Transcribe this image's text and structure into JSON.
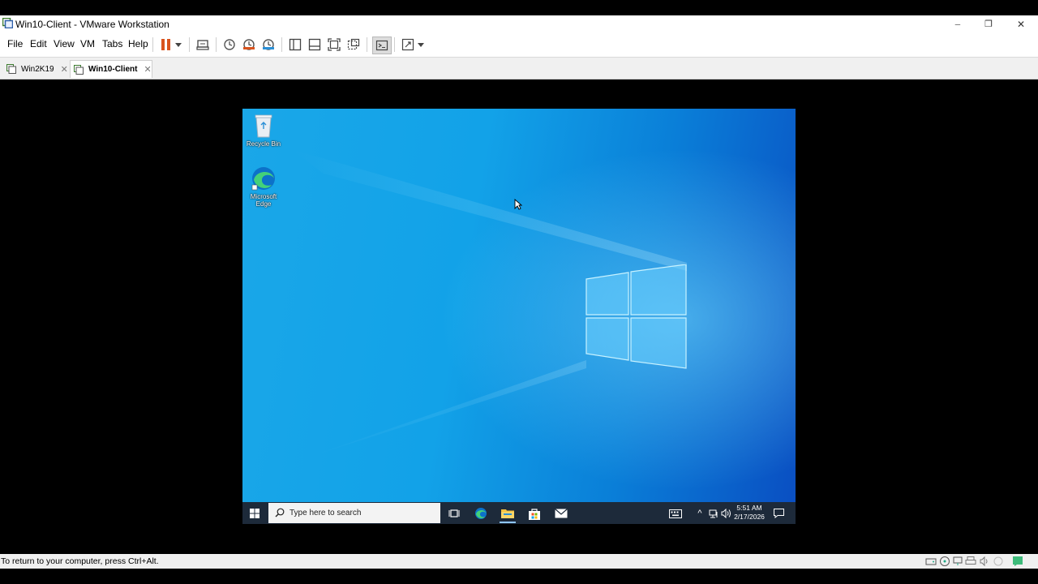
{
  "window": {
    "title": "Win10-Client - VMware Workstation",
    "controls": {
      "minimize": "─",
      "restore": "❐",
      "close": "✕"
    }
  },
  "menu": {
    "items": [
      "File",
      "Edit",
      "View",
      "VM",
      "Tabs",
      "Help"
    ]
  },
  "toolbar": {
    "icons": [
      "pause-icon",
      "dropdown-arrow-icon",
      "send-ctrl-alt-del-icon",
      "snapshot-icon",
      "revert-snapshot-icon",
      "snapshot-manager-icon",
      "library-icon",
      "thumbnail-bar-icon",
      "full-screen-icon",
      "unity-icon",
      "console-icon",
      "stretch-icon"
    ]
  },
  "tabs": [
    {
      "label": "Win2K19",
      "active": false,
      "close": "✕"
    },
    {
      "label": "Win10-Client",
      "active": true,
      "close": "✕"
    }
  ],
  "desktop": {
    "icons": [
      {
        "label_line1": "Recycle Bin",
        "label_line2": "",
        "icon": "recycle-bin-icon"
      },
      {
        "label_line1": "Microsoft",
        "label_line2": "Edge",
        "icon": "edge-icon"
      }
    ]
  },
  "taskbar": {
    "search_placeholder": "Type here to search",
    "clock_time": "5:51 AM",
    "clock_date": "2/17/2026",
    "chevron": "^"
  },
  "statusbar": {
    "message": "To return to your computer, press Ctrl+Alt."
  },
  "colors": {
    "pause": "#d9531e",
    "desktop_light": "#1aa7e8",
    "desktop_dark": "#0a4fc2",
    "taskbar": "#1d2a3a"
  }
}
